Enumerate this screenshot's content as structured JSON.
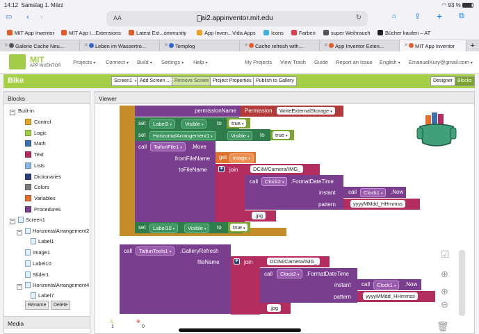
{
  "status": {
    "time": "14:12",
    "date": "Samstag 1. März",
    "battery": "93 %"
  },
  "browser": {
    "url": "ai2.appinventor.mit.edu",
    "aa": "AA"
  },
  "bookmarks": [
    "MIT App Inventor",
    "MIT App I...Extensions",
    "Latest Ext...ommunity",
    "App Inven...Vida Apps",
    "Icons",
    "Farben",
    "super Weihrauch",
    "Bücher kaufen – AT"
  ],
  "bookmark_colors": [
    "#e05c2a",
    "#e05c2a",
    "#e05c2a",
    "#f0a020",
    "#40b0e0",
    "#e04050",
    "#555555",
    "#222222"
  ],
  "tabs": [
    "Galerie Cache Neu...",
    "Leben im Wassertro...",
    "Templog",
    "Cache refresh with...",
    "App Inventor Exten...",
    "MIT App Inventor"
  ],
  "tab_colors": [
    "#555555",
    "#3366cc",
    "#3366cc",
    "#e05c2a",
    "#e05c2a",
    "#e05c2a"
  ],
  "app": {
    "logo_title": "MIT",
    "logo_sub": "APP INVENTOR",
    "menus": [
      "Projects",
      "Connect",
      "Build",
      "Settings",
      "Help"
    ],
    "right_links": [
      "My Projects",
      "View Trash",
      "Guide",
      "Report an Issue",
      "English",
      "EmanuelKury@gmail.com"
    ]
  },
  "toolbar": {
    "project_name": "Bike",
    "screen_select": "Screen1",
    "add_screen": "Add Screen ...",
    "remove_screen": "Remove Screen",
    "project_properties": "Project Properties",
    "publish": "Publish to Gallery",
    "designer": "Designer",
    "blocks": "Blocks"
  },
  "blocks_panel": {
    "title": "Blocks",
    "builtin": "Built-in",
    "items": [
      {
        "label": "Control",
        "color": "#e1a92e"
      },
      {
        "label": "Logic",
        "color": "#a5cf47"
      },
      {
        "label": "Math",
        "color": "#3a6fb0"
      },
      {
        "label": "Text",
        "color": "#b32d5e"
      },
      {
        "label": "Lists",
        "color": "#84b9e6"
      },
      {
        "label": "Dictionaries",
        "color": "#2d3e7e"
      },
      {
        "label": "Colors",
        "color": "#7d7d7d"
      },
      {
        "label": "Variables",
        "color": "#e0722e"
      },
      {
        "label": "Procedures",
        "color": "#7a3e8e"
      }
    ],
    "components": [
      "Screen1",
      "HorizontalArrangement2",
      "Label1",
      "Image1",
      "Label10",
      "Slider1",
      "HorizontalArrangement4",
      "Label7"
    ],
    "rename": "Rename",
    "delete": "Delete",
    "media": "Media"
  },
  "viewer": {
    "title": "Viewer",
    "b_permission": {
      "label": "permissionName",
      "kw": "Permission",
      "value": "WriteExternalStorage"
    },
    "b_set1": {
      "set": "set",
      "comp": "Label2",
      "prop": "Visible",
      "to": "to",
      "val": "true"
    },
    "b_set2": {
      "set": "set",
      "comp": "HorizontalArrangement1",
      "prop": "Visible",
      "to": "to",
      "val": "true"
    },
    "b_move": {
      "call": "call",
      "comp": "TaifunFile1",
      "method": ".Move",
      "from": "fromFileName",
      "to": "toFileName",
      "get": "get",
      "getval": "image"
    },
    "b_join1": {
      "join": "join",
      "s1": "DCIM/Camera/IMG_",
      "call": "call",
      "comp": "Clock2",
      "method": ".FormatDateTime",
      "instant": "instant",
      "clock": "Clock1",
      "now": ".Now",
      "pattern": "pattern",
      "patval": "yyyyMMdd_HHmmss",
      "ext": ".jpg"
    },
    "b_set3": {
      "set": "set",
      "comp": "Label10",
      "prop": "Visible",
      "to": "to",
      "val": "true"
    },
    "b_gallery": {
      "call": "call",
      "comp": "TaifunTools1",
      "method": ".GalleryRefresh",
      "file": "fileName"
    },
    "b_join2": {
      "join": "join",
      "s1": "DCIM/Camera/IMG_",
      "call": "call",
      "comp": "Clock2",
      "method": ".FormatDateTime",
      "instant": "instant",
      "clock": "Clock1",
      "now": ".Now",
      "pattern": "pattern",
      "patval": "yyyyMMdd_HHmmss",
      "ext": ".jpg"
    },
    "warnings": "1",
    "errors": "0"
  }
}
